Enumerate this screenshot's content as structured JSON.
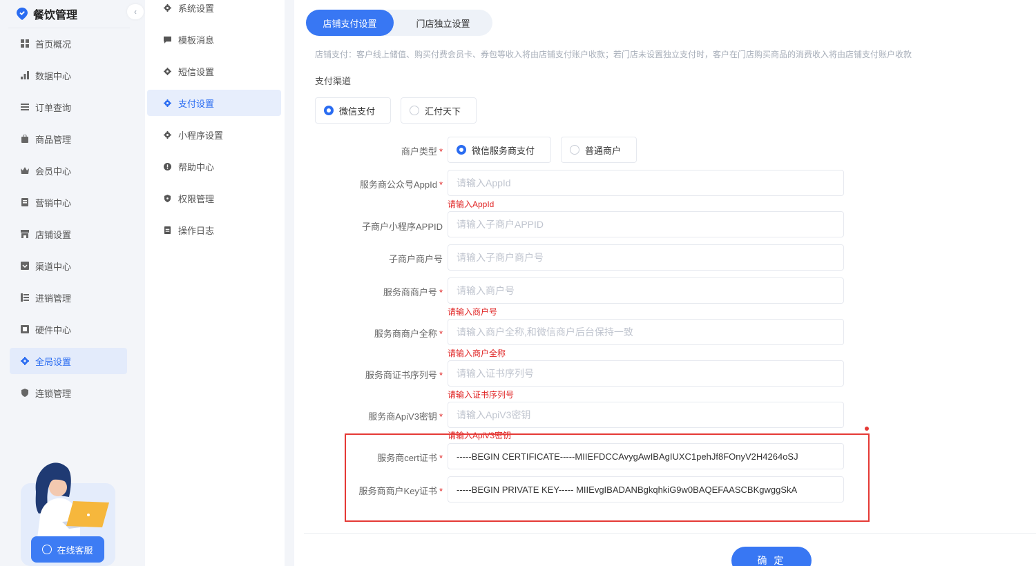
{
  "brand": {
    "title": "餐饮管理",
    "logo_icon": "location-pin-icon",
    "collapse_icon": "chevron-left-icon"
  },
  "nav1": [
    {
      "label": "首页概况",
      "icon": "grid-icon",
      "active": false
    },
    {
      "label": "数据中心",
      "icon": "bar-chart-icon",
      "active": false
    },
    {
      "label": "订单查询",
      "icon": "list-icon",
      "active": false
    },
    {
      "label": "商品管理",
      "icon": "bag-icon",
      "active": false
    },
    {
      "label": "会员中心",
      "icon": "crown-icon",
      "active": false
    },
    {
      "label": "营销中心",
      "icon": "gift-icon",
      "active": false
    },
    {
      "label": "店铺设置",
      "icon": "store-icon",
      "active": false
    },
    {
      "label": "渠道中心",
      "icon": "channel-icon",
      "active": false
    },
    {
      "label": "进销管理",
      "icon": "inventory-icon",
      "active": false
    },
    {
      "label": "硬件中心",
      "icon": "device-icon",
      "active": false
    },
    {
      "label": "全局设置",
      "icon": "gear-icon",
      "active": true
    },
    {
      "label": "连锁管理",
      "icon": "shield-icon",
      "active": false
    }
  ],
  "customer_service": {
    "label": "在线客服",
    "icon": "chat-icon"
  },
  "nav2": [
    {
      "label": "系统设置",
      "icon": "gear-icon",
      "active": false
    },
    {
      "label": "模板消息",
      "icon": "message-icon",
      "active": false
    },
    {
      "label": "短信设置",
      "icon": "gear-icon",
      "active": false
    },
    {
      "label": "支付设置",
      "icon": "gear-icon",
      "active": true
    },
    {
      "label": "小程序设置",
      "icon": "gear-icon",
      "active": false
    },
    {
      "label": "帮助中心",
      "icon": "info-icon",
      "active": false
    },
    {
      "label": "权限管理",
      "icon": "lock-icon",
      "active": false
    },
    {
      "label": "操作日志",
      "icon": "document-icon",
      "active": false
    }
  ],
  "tabs": [
    {
      "label": "店铺支付设置",
      "active": true
    },
    {
      "label": "门店独立设置",
      "active": false
    }
  ],
  "notice": "店铺支付：客户线上储值、购买付费会员卡、券包等收入将由店铺支付账户收款；若门店未设置独立支付时，客户在门店购买商品的消费收入将由店铺支付账户收款",
  "channel": {
    "label": "支付渠道",
    "options": [
      {
        "label": "微信支付",
        "selected": true
      },
      {
        "label": "汇付天下",
        "selected": false
      }
    ]
  },
  "merchant_type": {
    "label": "商户类型",
    "options": [
      {
        "label": "微信服务商支付",
        "selected": true
      },
      {
        "label": "普通商户",
        "selected": false
      }
    ]
  },
  "fields": [
    {
      "label": "服务商公众号AppId",
      "placeholder": "请输入AppId",
      "value": "",
      "required": true,
      "error": "请输入AppId"
    },
    {
      "label": "子商户小程序APPID",
      "placeholder": "请输入子商户APPID",
      "value": "",
      "required": false,
      "error": ""
    },
    {
      "label": "子商户商户号",
      "placeholder": "请输入子商户商户号",
      "value": "",
      "required": false,
      "error": ""
    },
    {
      "label": "服务商商户号",
      "placeholder": "请输入商户号",
      "value": "",
      "required": true,
      "error": "请输入商户号"
    },
    {
      "label": "服务商商户全称",
      "placeholder": "请输入商户全称,和微信商户后台保持一致",
      "value": "",
      "required": true,
      "error": "请输入商户全称"
    },
    {
      "label": "服务商证书序列号",
      "placeholder": "请输入证书序列号",
      "value": "",
      "required": true,
      "error": "请输入证书序列号"
    },
    {
      "label": "服务商ApiV3密钥",
      "placeholder": "请输入ApiV3密钥",
      "value": "",
      "required": true,
      "error": "请输入ApiV3密钥"
    },
    {
      "label": "服务商cert证书",
      "placeholder": "",
      "value": "-----BEGIN CERTIFICATE-----MIIEFDCCAvygAwIBAgIUXC1pehJf8FOnyV2H4264oSJ",
      "required": true,
      "error": ""
    },
    {
      "label": "服务商商户Key证书",
      "placeholder": "",
      "value": "-----BEGIN PRIVATE KEY----- MIIEvgIBADANBgkqhkiG9w0BAQEFAASCBKgwggSkA",
      "required": true,
      "error": ""
    }
  ],
  "required_mark": "*",
  "confirm_label": "确 定",
  "colors": {
    "primary": "#3877f3",
    "error": "#e02424",
    "highlight": "#e53935"
  }
}
